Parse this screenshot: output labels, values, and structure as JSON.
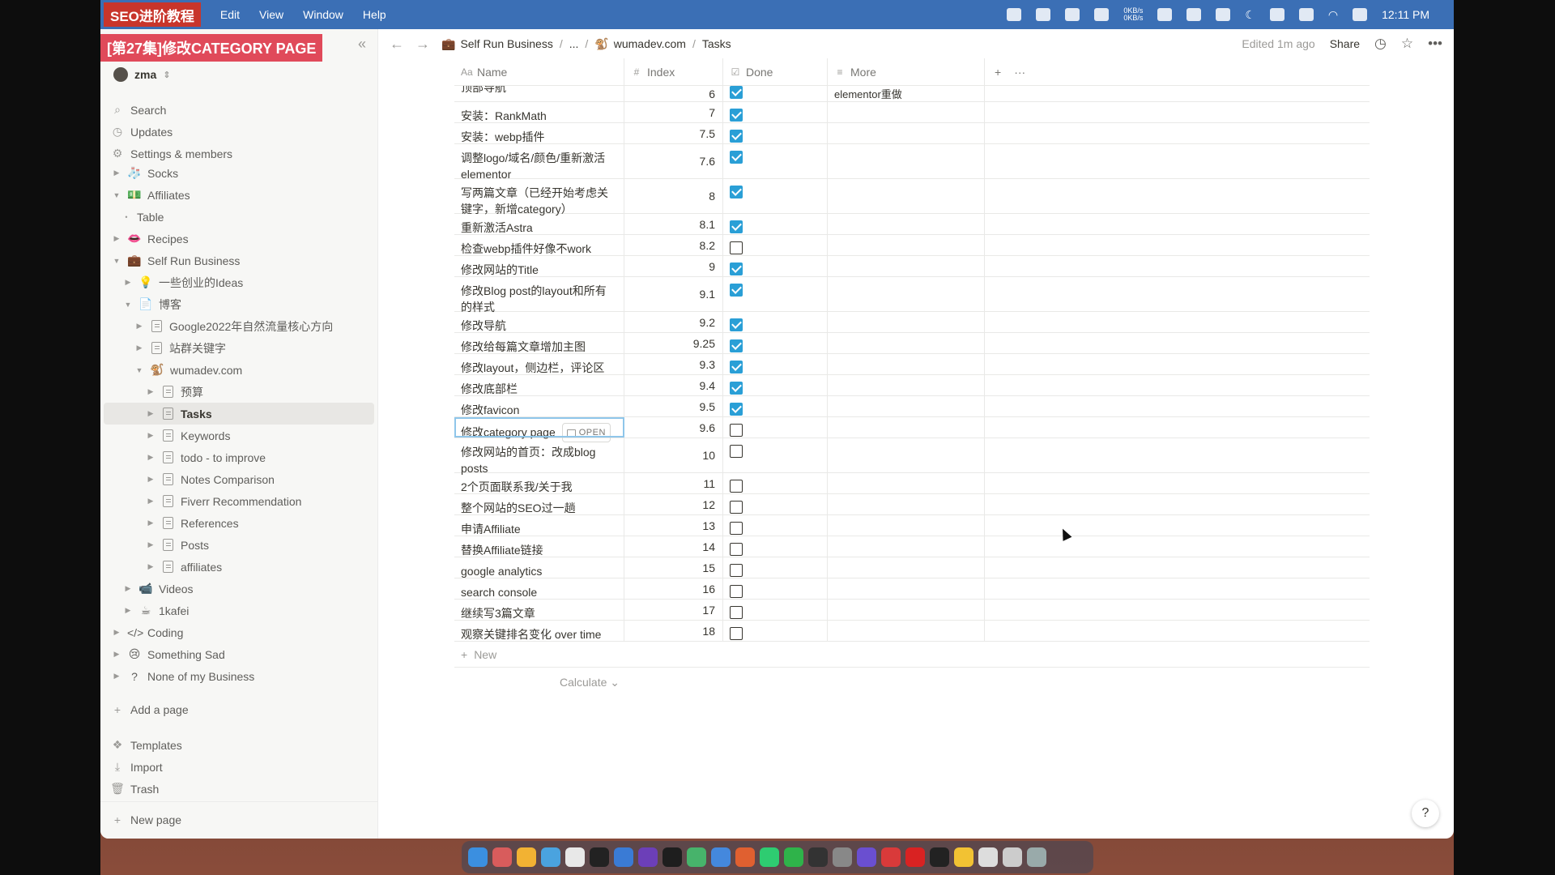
{
  "menubar": {
    "brand": "SEO进阶教程",
    "menus": [
      "Edit",
      "View",
      "Window",
      "Help"
    ],
    "net_up": "0KB/s",
    "net_down": "0KB/s",
    "time": "12:11 PM"
  },
  "sidebar": {
    "episode_badge": "[第27集]修改CATEGORY PAGE",
    "workspace": "zma",
    "top_items": [
      {
        "label": "Search",
        "icon": "search-icon"
      },
      {
        "label": "Updates",
        "icon": "clock-icon"
      },
      {
        "label": "Settings & members",
        "icon": "gear-icon"
      }
    ],
    "tree": [
      {
        "label": "Socks",
        "emoji": "🧦",
        "expanded": false
      },
      {
        "label": "Affiliates",
        "emoji": "💵",
        "expanded": true
      },
      {
        "label": "Table",
        "emoji": "",
        "expanded": false
      },
      {
        "label": "Recipes",
        "emoji": "👄",
        "expanded": false
      },
      {
        "label": "Self Run Business",
        "emoji": "💼",
        "expanded": true
      },
      {
        "label": "一些创业的Ideas",
        "emoji": "💡",
        "expanded": false
      },
      {
        "label": "博客",
        "emoji": "📄",
        "expanded": true
      },
      {
        "label": "Google2022年自然流量核心方向",
        "emoji": "",
        "expanded": false
      },
      {
        "label": "站群关键字",
        "emoji": "",
        "expanded": false
      },
      {
        "label": "wumadev.com",
        "emoji": "🐒",
        "expanded": true
      },
      {
        "label": "预算",
        "emoji": "",
        "expanded": false
      },
      {
        "label": "Tasks",
        "emoji": "",
        "expanded": false
      },
      {
        "label": "Keywords",
        "emoji": "",
        "expanded": false
      },
      {
        "label": "todo - to improve",
        "emoji": "",
        "expanded": false
      },
      {
        "label": "Notes Comparison",
        "emoji": "",
        "expanded": false
      },
      {
        "label": "Fiverr Recommendation",
        "emoji": "",
        "expanded": false
      },
      {
        "label": "References",
        "emoji": "",
        "expanded": false
      },
      {
        "label": "Posts",
        "emoji": "",
        "expanded": false
      },
      {
        "label": "affiliates",
        "emoji": "",
        "expanded": false
      },
      {
        "label": "Videos",
        "emoji": "📹",
        "expanded": false
      },
      {
        "label": "1kafei",
        "emoji": "☕",
        "expanded": false
      },
      {
        "label": "Coding",
        "emoji": "</>",
        "expanded": false
      },
      {
        "label": "Something Sad",
        "emoji": "😢",
        "expanded": false
      },
      {
        "label": "None of my Business",
        "emoji": "?",
        "expanded": false
      }
    ],
    "add_page": "Add a page",
    "bottom_items": [
      {
        "label": "Templates",
        "icon": "templates-icon"
      },
      {
        "label": "Import",
        "icon": "import-icon"
      },
      {
        "label": "Trash",
        "icon": "trash-icon"
      }
    ],
    "new_page": "New page"
  },
  "topbar": {
    "breadcrumb": [
      "Self Run Business",
      "...",
      "wumadev.com",
      "Tasks"
    ],
    "edited": "Edited 1m ago",
    "share": "Share"
  },
  "table": {
    "columns": [
      "Name",
      "Index",
      "Done",
      "More"
    ],
    "rows": [
      {
        "name": "顶部导航",
        "index": "6",
        "done": true,
        "more": "elementor重做"
      },
      {
        "name": "安装：RankMath",
        "index": "7",
        "done": true,
        "more": ""
      },
      {
        "name": "安装：webp插件",
        "index": "7.5",
        "done": true,
        "more": ""
      },
      {
        "name": "调整logo/域名/颜色/重新激活elementor",
        "index": "7.6",
        "done": true,
        "more": ""
      },
      {
        "name": "写两篇文章（已经开始考虑关键字，新增category）",
        "index": "8",
        "done": true,
        "more": ""
      },
      {
        "name": "重新激活Astra",
        "index": "8.1",
        "done": true,
        "more": ""
      },
      {
        "name": "检查webp插件好像不work",
        "index": "8.2",
        "done": false,
        "more": ""
      },
      {
        "name": "修改网站的Title",
        "index": "9",
        "done": true,
        "more": ""
      },
      {
        "name": "修改Blog post的layout和所有的样式",
        "index": "9.1",
        "done": true,
        "more": ""
      },
      {
        "name": "修改导航",
        "index": "9.2",
        "done": true,
        "more": ""
      },
      {
        "name": "修改给每篇文章增加主图",
        "index": "9.25",
        "done": true,
        "more": ""
      },
      {
        "name": "修改layout，侧边栏，评论区",
        "index": "9.3",
        "done": true,
        "more": ""
      },
      {
        "name": "修改底部栏",
        "index": "9.4",
        "done": true,
        "more": ""
      },
      {
        "name": "修改favicon",
        "index": "9.5",
        "done": true,
        "more": ""
      },
      {
        "name": "修改category page",
        "index": "9.6",
        "done": false,
        "more": ""
      },
      {
        "name": "修改网站的首页：改成blog posts",
        "index": "10",
        "done": false,
        "more": ""
      },
      {
        "name": "2个页面联系我/关于我",
        "index": "11",
        "done": false,
        "more": ""
      },
      {
        "name": "整个网站的SEO过一趟",
        "index": "12",
        "done": false,
        "more": ""
      },
      {
        "name": "申请Affiliate",
        "index": "13",
        "done": false,
        "more": ""
      },
      {
        "name": "替换Affiliate链接",
        "index": "14",
        "done": false,
        "more": ""
      },
      {
        "name": "google analytics",
        "index": "15",
        "done": false,
        "more": ""
      },
      {
        "name": "search console",
        "index": "16",
        "done": false,
        "more": ""
      },
      {
        "name": "继续写3篇文章",
        "index": "17",
        "done": false,
        "more": ""
      },
      {
        "name": "观察关键排名变化 over time",
        "index": "18",
        "done": false,
        "more": ""
      }
    ],
    "open_label": "OPEN",
    "new_label": "New",
    "calculate_label": "Calculate"
  },
  "help_label": "?",
  "colors": {
    "accent": "#2a9fd6",
    "menubar": "#3b6fb5",
    "badge": "#c8352b",
    "episode": "#e04a5a"
  }
}
